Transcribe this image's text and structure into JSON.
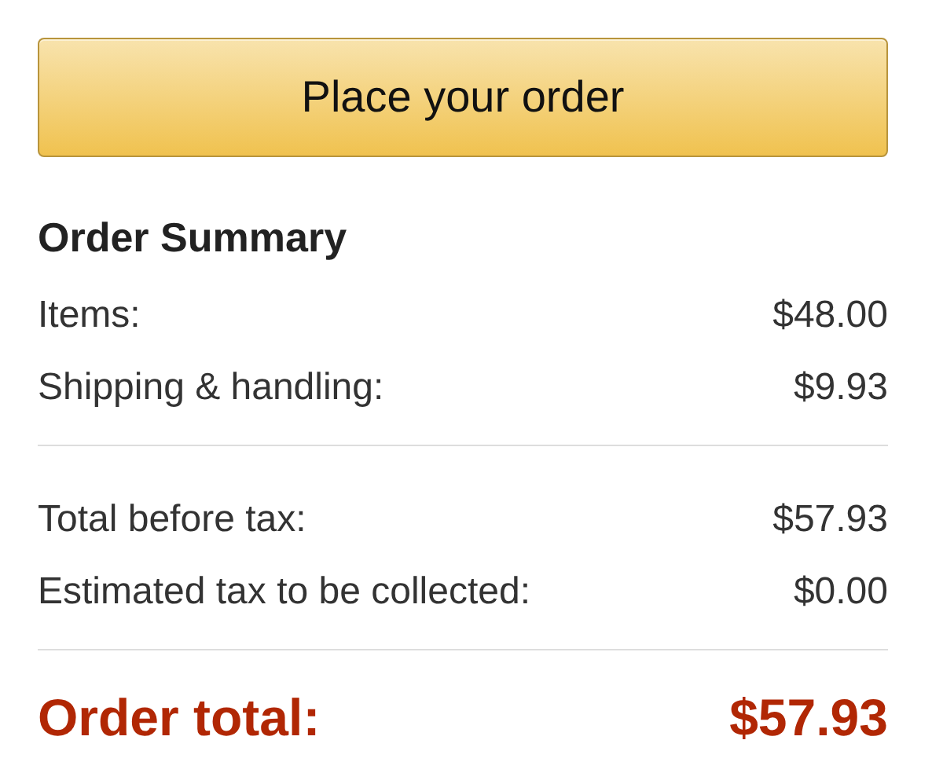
{
  "place_order_button": {
    "label": "Place your order"
  },
  "order_summary": {
    "title": "Order Summary",
    "sections": [
      {
        "rows": [
          {
            "label": "Items:",
            "amount": "$48.00"
          },
          {
            "label": "Shipping & handling:",
            "amount": "$9.93"
          }
        ]
      },
      {
        "rows": [
          {
            "label": "Total before tax:",
            "amount": "$57.93"
          },
          {
            "label": "Estimated tax to be collected:",
            "amount": "$0.00"
          }
        ]
      }
    ],
    "total": {
      "label": "Order total:",
      "amount": "$57.93"
    }
  }
}
